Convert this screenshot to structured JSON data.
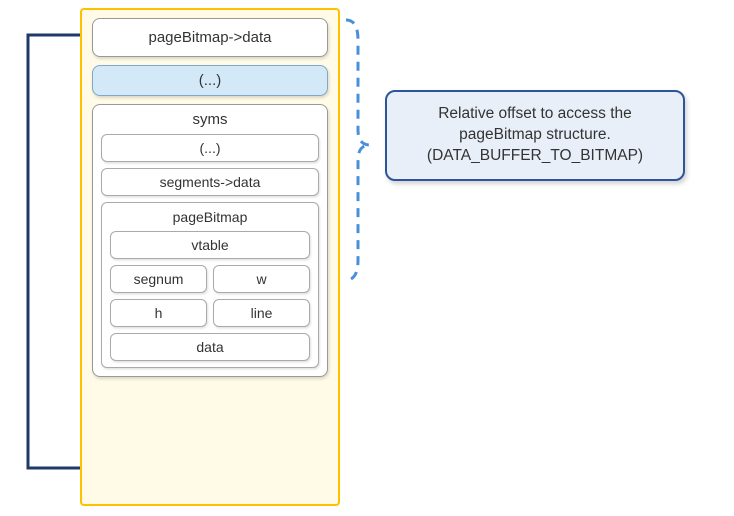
{
  "main": {
    "top_box": "pageBitmap->data",
    "ellipsis": "(...)",
    "syms": {
      "title": "syms",
      "ellipsis": "(...)",
      "segments": "segments->data",
      "pageBitmap": {
        "title": "pageBitmap",
        "vtable": "vtable",
        "segnum": "segnum",
        "w": "w",
        "h": "h",
        "line": "line",
        "data": "data"
      }
    }
  },
  "callout": {
    "line1": "Relative offset to access the",
    "line2": "pageBitmap structure.",
    "line3": "(DATA_BUFFER_TO_BITMAP)"
  },
  "colors": {
    "container_border": "#FFC000",
    "container_bg": "#FFFBE6",
    "highlight_bg": "#D4E9F7",
    "callout_bg": "#E8EFF9",
    "callout_border": "#2E5597",
    "brace_color": "#4A90D9",
    "arrow_color": "#1F3A68"
  }
}
